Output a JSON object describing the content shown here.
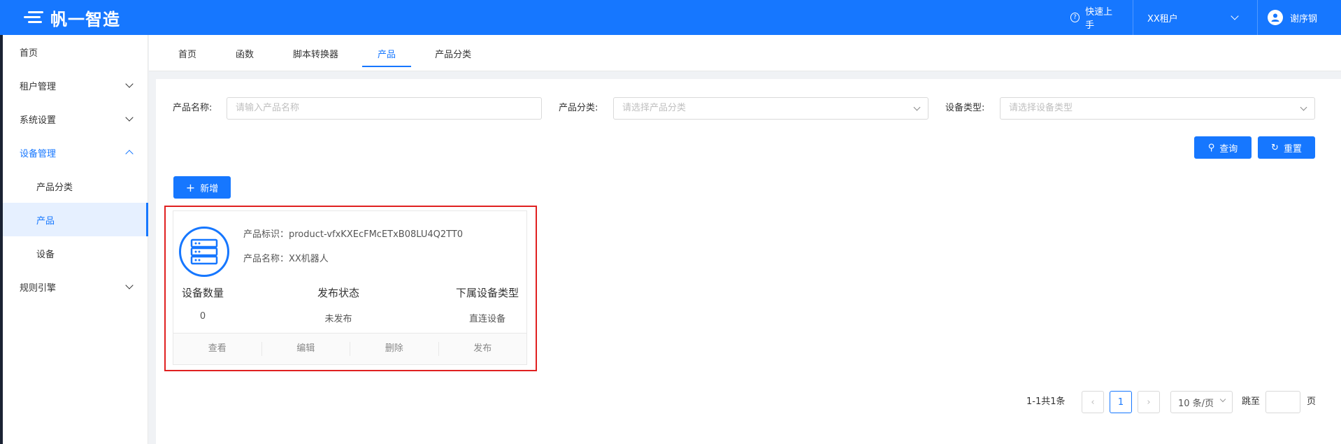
{
  "app": {
    "title": "帆一智造"
  },
  "header": {
    "help_label": "快速上手",
    "tenant_label": "XX租户",
    "user_name": "谢序钢"
  },
  "sidebar": {
    "items": [
      {
        "label": "首页"
      },
      {
        "label": "租户管理"
      },
      {
        "label": "系统设置"
      },
      {
        "label": "设备管理"
      },
      {
        "label": "产品分类"
      },
      {
        "label": "产品"
      },
      {
        "label": "设备"
      },
      {
        "label": "规则引擎"
      }
    ]
  },
  "tabs": [
    {
      "label": "首页"
    },
    {
      "label": "函数"
    },
    {
      "label": "脚本转换器"
    },
    {
      "label": "产品"
    },
    {
      "label": "产品分类"
    }
  ],
  "filters": {
    "name_label": "产品名称:",
    "name_placeholder": "请输入产品名称",
    "category_label": "产品分类:",
    "category_placeholder": "请选择产品分类",
    "device_type_label": "设备类型:",
    "device_type_placeholder": "请选择设备类型"
  },
  "buttons": {
    "query": "查询",
    "reset": "重置",
    "add": "新增"
  },
  "card": {
    "id_line": "产品标识：product-vfxKXEcFMcETxB08LU4Q2TT0",
    "name_line": "产品名称：XX机器人",
    "stats": [
      {
        "title": "设备数量",
        "value": "0"
      },
      {
        "title": "发布状态",
        "value": "未发布"
      },
      {
        "title": "下属设备类型",
        "value": "直连设备"
      }
    ],
    "actions": [
      "查看",
      "编辑",
      "删除",
      "发布"
    ]
  },
  "pagination": {
    "summary": "1-1共1条",
    "current_page": "1",
    "page_size": "10 条/页",
    "jump_label": "跳至",
    "page_suffix": "页"
  },
  "colors": {
    "primary": "#1677ff",
    "highlight_border": "#e02020"
  }
}
